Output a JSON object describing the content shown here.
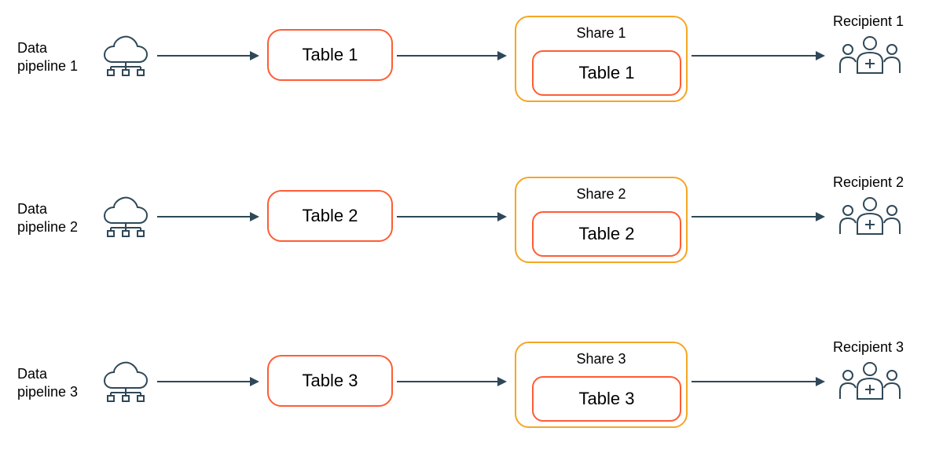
{
  "rows": [
    {
      "pipeline_label": "Data\npipeline 1",
      "table_label": "Table 1",
      "share_label": "Share 1",
      "share_table_label": "Table 1",
      "recipient_label": "Recipient 1"
    },
    {
      "pipeline_label": "Data\npipeline 2",
      "table_label": "Table 2",
      "share_label": "Share 2",
      "share_table_label": "Table 2",
      "recipient_label": "Recipient 2"
    },
    {
      "pipeline_label": "Data\npipeline 3",
      "table_label": "Table 3",
      "share_label": "Share 3",
      "share_table_label": "Table 3",
      "recipient_label": "Recipient 3"
    }
  ],
  "colors": {
    "arrow": "#2f4858",
    "table_border": "#ff5c35",
    "share_border": "#f5a623",
    "icon_stroke": "#2f4858"
  }
}
